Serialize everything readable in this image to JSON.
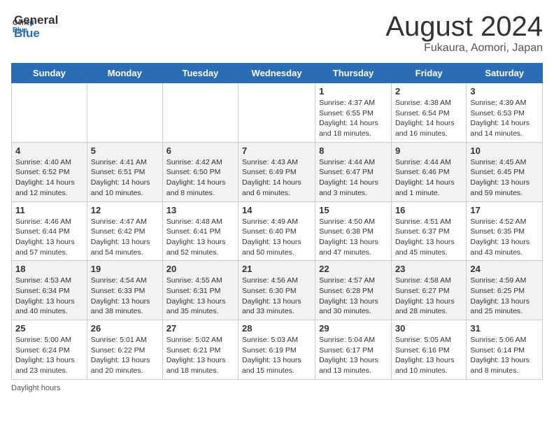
{
  "header": {
    "logo_general": "General",
    "logo_blue": "Blue",
    "title": "August 2024",
    "subtitle": "Fukaura, Aomori, Japan"
  },
  "days_of_week": [
    "Sunday",
    "Monday",
    "Tuesday",
    "Wednesday",
    "Thursday",
    "Friday",
    "Saturday"
  ],
  "weeks": [
    [
      {
        "day": "",
        "info": ""
      },
      {
        "day": "",
        "info": ""
      },
      {
        "day": "",
        "info": ""
      },
      {
        "day": "",
        "info": ""
      },
      {
        "day": "1",
        "info": "Sunrise: 4:37 AM\nSunset: 6:55 PM\nDaylight: 14 hours and 18 minutes."
      },
      {
        "day": "2",
        "info": "Sunrise: 4:38 AM\nSunset: 6:54 PM\nDaylight: 14 hours and 16 minutes."
      },
      {
        "day": "3",
        "info": "Sunrise: 4:39 AM\nSunset: 6:53 PM\nDaylight: 14 hours and 14 minutes."
      }
    ],
    [
      {
        "day": "4",
        "info": "Sunrise: 4:40 AM\nSunset: 6:52 PM\nDaylight: 14 hours and 12 minutes."
      },
      {
        "day": "5",
        "info": "Sunrise: 4:41 AM\nSunset: 6:51 PM\nDaylight: 14 hours and 10 minutes."
      },
      {
        "day": "6",
        "info": "Sunrise: 4:42 AM\nSunset: 6:50 PM\nDaylight: 14 hours and 8 minutes."
      },
      {
        "day": "7",
        "info": "Sunrise: 4:43 AM\nSunset: 6:49 PM\nDaylight: 14 hours and 6 minutes."
      },
      {
        "day": "8",
        "info": "Sunrise: 4:44 AM\nSunset: 6:47 PM\nDaylight: 14 hours and 3 minutes."
      },
      {
        "day": "9",
        "info": "Sunrise: 4:44 AM\nSunset: 6:46 PM\nDaylight: 14 hours and 1 minute."
      },
      {
        "day": "10",
        "info": "Sunrise: 4:45 AM\nSunset: 6:45 PM\nDaylight: 13 hours and 59 minutes."
      }
    ],
    [
      {
        "day": "11",
        "info": "Sunrise: 4:46 AM\nSunset: 6:44 PM\nDaylight: 13 hours and 57 minutes."
      },
      {
        "day": "12",
        "info": "Sunrise: 4:47 AM\nSunset: 6:42 PM\nDaylight: 13 hours and 54 minutes."
      },
      {
        "day": "13",
        "info": "Sunrise: 4:48 AM\nSunset: 6:41 PM\nDaylight: 13 hours and 52 minutes."
      },
      {
        "day": "14",
        "info": "Sunrise: 4:49 AM\nSunset: 6:40 PM\nDaylight: 13 hours and 50 minutes."
      },
      {
        "day": "15",
        "info": "Sunrise: 4:50 AM\nSunset: 6:38 PM\nDaylight: 13 hours and 47 minutes."
      },
      {
        "day": "16",
        "info": "Sunrise: 4:51 AM\nSunset: 6:37 PM\nDaylight: 13 hours and 45 minutes."
      },
      {
        "day": "17",
        "info": "Sunrise: 4:52 AM\nSunset: 6:35 PM\nDaylight: 13 hours and 43 minutes."
      }
    ],
    [
      {
        "day": "18",
        "info": "Sunrise: 4:53 AM\nSunset: 6:34 PM\nDaylight: 13 hours and 40 minutes."
      },
      {
        "day": "19",
        "info": "Sunrise: 4:54 AM\nSunset: 6:33 PM\nDaylight: 13 hours and 38 minutes."
      },
      {
        "day": "20",
        "info": "Sunrise: 4:55 AM\nSunset: 6:31 PM\nDaylight: 13 hours and 35 minutes."
      },
      {
        "day": "21",
        "info": "Sunrise: 4:56 AM\nSunset: 6:30 PM\nDaylight: 13 hours and 33 minutes."
      },
      {
        "day": "22",
        "info": "Sunrise: 4:57 AM\nSunset: 6:28 PM\nDaylight: 13 hours and 30 minutes."
      },
      {
        "day": "23",
        "info": "Sunrise: 4:58 AM\nSunset: 6:27 PM\nDaylight: 13 hours and 28 minutes."
      },
      {
        "day": "24",
        "info": "Sunrise: 4:59 AM\nSunset: 6:25 PM\nDaylight: 13 hours and 25 minutes."
      }
    ],
    [
      {
        "day": "25",
        "info": "Sunrise: 5:00 AM\nSunset: 6:24 PM\nDaylight: 13 hours and 23 minutes."
      },
      {
        "day": "26",
        "info": "Sunrise: 5:01 AM\nSunset: 6:22 PM\nDaylight: 13 hours and 20 minutes."
      },
      {
        "day": "27",
        "info": "Sunrise: 5:02 AM\nSunset: 6:21 PM\nDaylight: 13 hours and 18 minutes."
      },
      {
        "day": "28",
        "info": "Sunrise: 5:03 AM\nSunset: 6:19 PM\nDaylight: 13 hours and 15 minutes."
      },
      {
        "day": "29",
        "info": "Sunrise: 5:04 AM\nSunset: 6:17 PM\nDaylight: 13 hours and 13 minutes."
      },
      {
        "day": "30",
        "info": "Sunrise: 5:05 AM\nSunset: 6:16 PM\nDaylight: 13 hours and 10 minutes."
      },
      {
        "day": "31",
        "info": "Sunrise: 5:06 AM\nSunset: 6:14 PM\nDaylight: 13 hours and 8 minutes."
      }
    ]
  ],
  "footer": {
    "note": "Daylight hours"
  }
}
